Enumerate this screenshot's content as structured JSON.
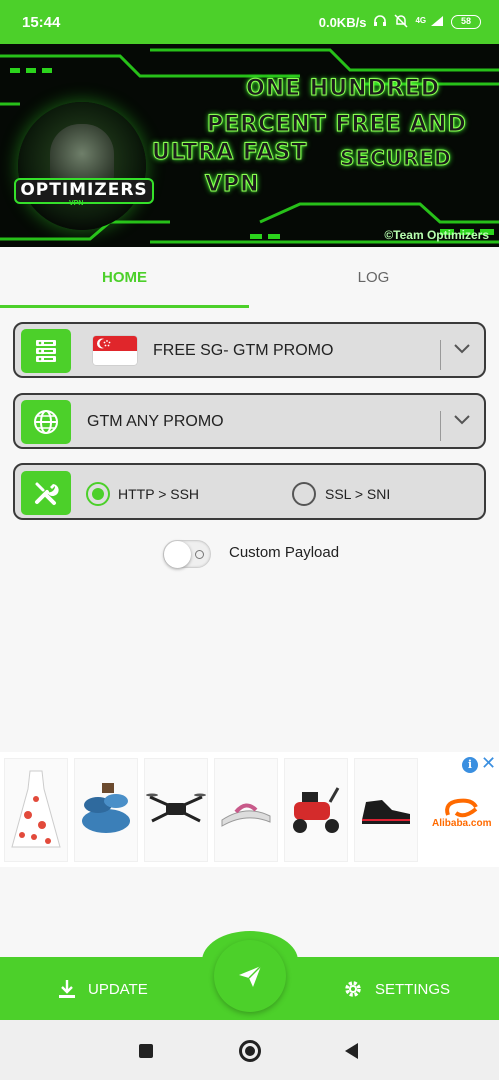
{
  "status_bar": {
    "time": "15:44",
    "speed": "0.0KB/s",
    "network": "4G",
    "battery": "58"
  },
  "banner": {
    "logo_title": "OPTIMIZERS",
    "logo_subtitle": "VPN",
    "tagline": [
      "ONE HUNDRED",
      "PERCENT FREE AND",
      "ULTRA FAST",
      "SECURED",
      "VPN"
    ],
    "credit": "©Team Optimizers"
  },
  "tabs": [
    {
      "label": "HOME",
      "active": true
    },
    {
      "label": "LOG",
      "active": false
    }
  ],
  "server_select": {
    "value": "FREE SG- GTM PROMO",
    "icon": "server-icon",
    "flag": "singapore-flag"
  },
  "payload_select": {
    "value": "GTM ANY PROMO",
    "icon": "globe-icon"
  },
  "protocol": {
    "icon": "tools-icon",
    "options": [
      {
        "label": "HTTP > SSH",
        "selected": true
      },
      {
        "label": "SSL > SNI",
        "selected": false
      }
    ]
  },
  "custom_payload": {
    "label": "Custom Payload",
    "enabled": false
  },
  "ad": {
    "items": [
      "floral-dress",
      "cookware-set",
      "drone",
      "sandals",
      "tricycle-scooter",
      "sneaker",
      "alibaba-logo"
    ],
    "advertiser_text": "Alibaba.com"
  },
  "bottom_bar": {
    "update_label": "UPDATE",
    "settings_label": "SETTINGS",
    "connect_icon": "send-icon"
  },
  "colors": {
    "accent": "#4cd02a",
    "card_bg": "#dedede",
    "card_border": "#3a3a3a"
  }
}
